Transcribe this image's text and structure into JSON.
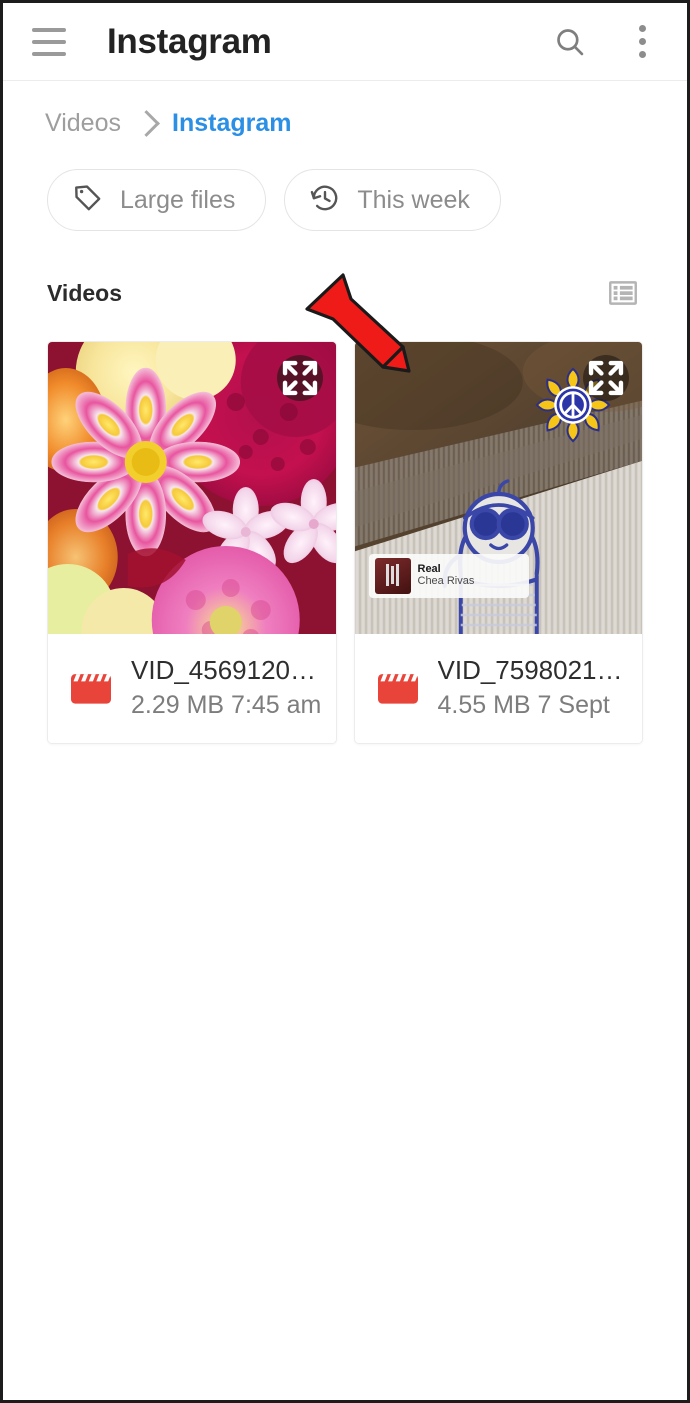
{
  "appbar": {
    "title": "Instagram",
    "menu_icon": "hamburger-menu-icon",
    "search_icon": "search-icon",
    "overflow_icon": "more-vertical-icon"
  },
  "breadcrumb": {
    "parent": "Videos",
    "separator": "chevron-right-icon",
    "current": "Instagram",
    "current_color": "#2b8fe5"
  },
  "chips": [
    {
      "label": "Large files",
      "icon": "tag-icon"
    },
    {
      "label": "This week",
      "icon": "history-icon"
    }
  ],
  "section": {
    "title": "Videos",
    "view_toggle_icon": "list-view-icon"
  },
  "files": [
    {
      "name": "VID_4569120…",
      "size": "2.29 MB",
      "time": "7:45 am",
      "meta": "2.29 MB 7:45 am",
      "type_icon": "video-clapperboard-icon",
      "type_icon_color": "#e8443a",
      "expand_icon": "expand-fullscreen-icon",
      "thumbnail": "flowers-photo"
    },
    {
      "name": "VID_7598021…",
      "size": "4.55 MB",
      "time": "7 Sept",
      "meta": "4.55 MB 7 Sept",
      "type_icon": "video-clapperboard-icon",
      "type_icon_color": "#e8443a",
      "expand_icon": "expand-fullscreen-icon",
      "thumbnail": "doodle-character-photo",
      "overlays": {
        "flower_sticker": "peace-flower-sticker",
        "music_title": "Real",
        "music_artist": "Chea Rivas"
      }
    }
  ],
  "annotation": {
    "arrow": "red-down-right-arrow",
    "color": "#ef1b18"
  }
}
